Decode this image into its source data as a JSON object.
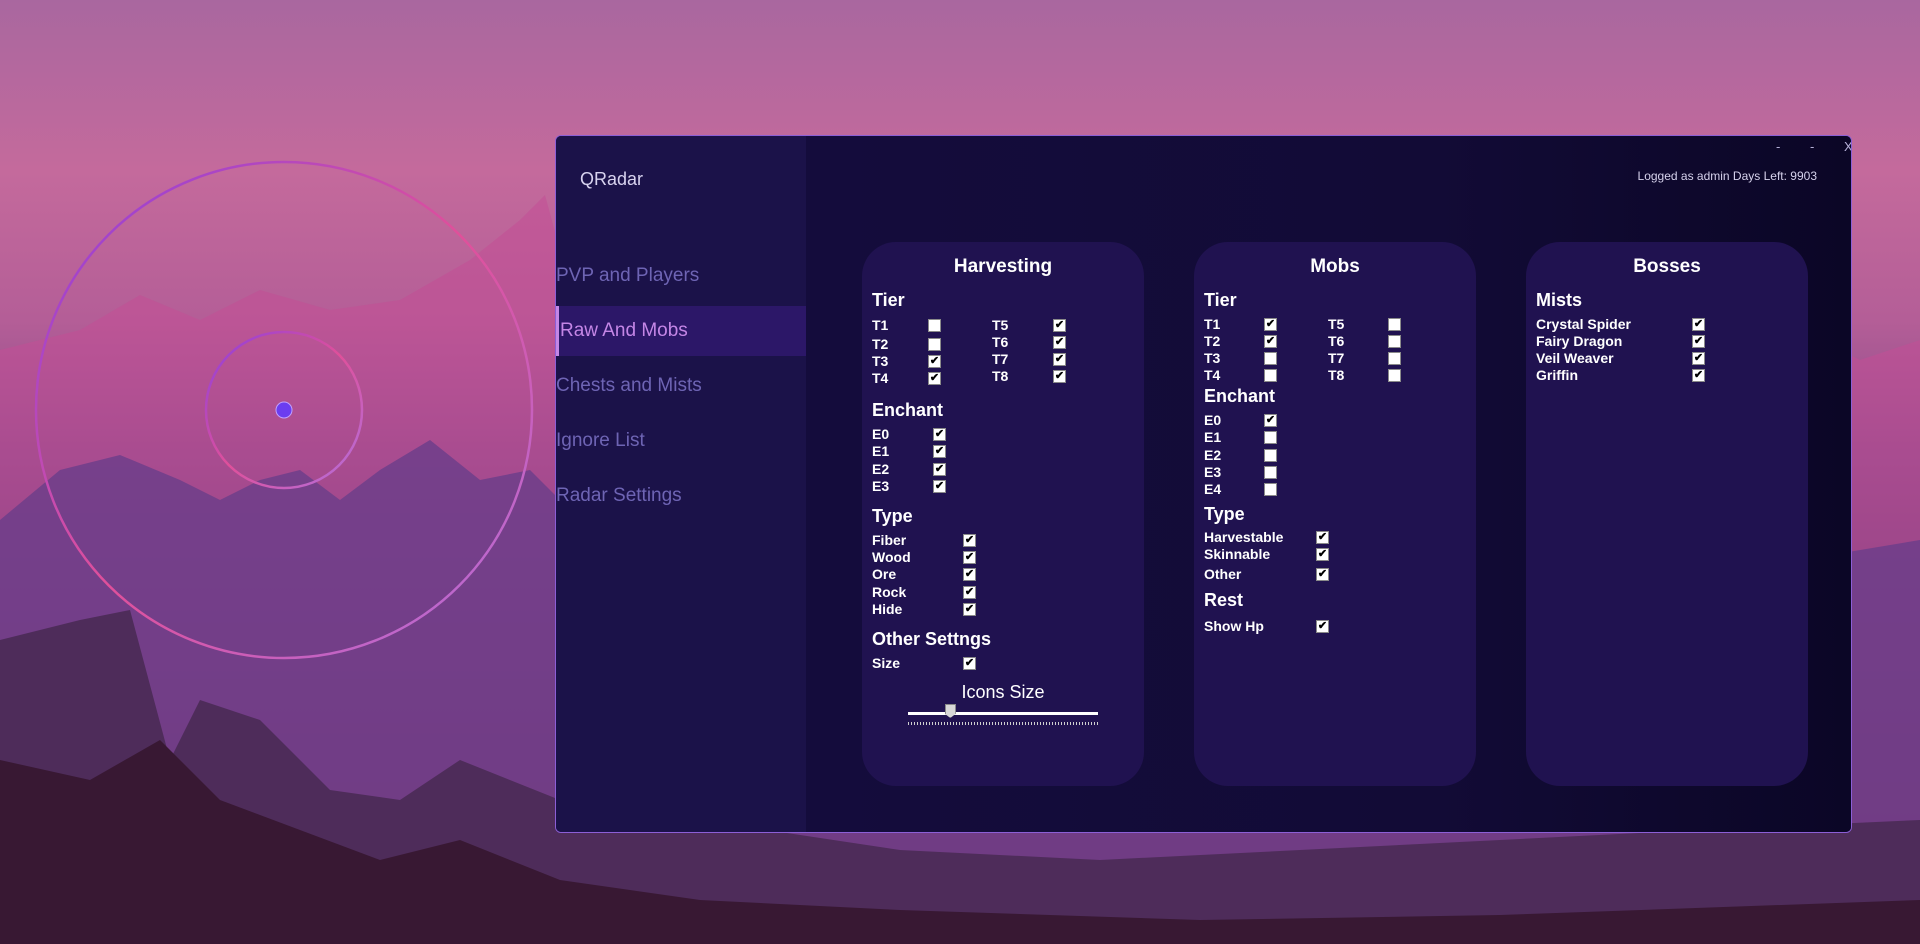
{
  "app": {
    "title": "QRadar"
  },
  "window_controls": {
    "minimize": "-",
    "maximize": "-",
    "close": "X"
  },
  "status": "Logged as admin Days Left: 9903",
  "nav": [
    {
      "label": "PVP and Players",
      "active": false
    },
    {
      "label": "Raw And Mobs",
      "active": true
    },
    {
      "label": "Chests and Mists",
      "active": false
    },
    {
      "label": "Ignore List",
      "active": false
    },
    {
      "label": "Radar Settings",
      "active": false
    }
  ],
  "harvesting": {
    "title": "Harvesting",
    "tier_title": "Tier",
    "tiers": [
      {
        "label": "T1",
        "checked": false
      },
      {
        "label": "T2",
        "checked": false
      },
      {
        "label": "T3",
        "checked": true
      },
      {
        "label": "T4",
        "checked": true
      },
      {
        "label": "T5",
        "checked": true
      },
      {
        "label": "T6",
        "checked": true
      },
      {
        "label": "T7",
        "checked": true
      },
      {
        "label": "T8",
        "checked": true
      }
    ],
    "enchant_title": "Enchant",
    "enchants": [
      {
        "label": "E0",
        "checked": true
      },
      {
        "label": "E1",
        "checked": true
      },
      {
        "label": "E2",
        "checked": true
      },
      {
        "label": "E3",
        "checked": true
      }
    ],
    "type_title": "Type",
    "types": [
      {
        "label": "Fiber",
        "checked": true
      },
      {
        "label": "Wood",
        "checked": true
      },
      {
        "label": "Ore",
        "checked": true
      },
      {
        "label": "Rock",
        "checked": true
      },
      {
        "label": "Hide",
        "checked": true
      }
    ],
    "other_title": "Other Settngs",
    "size": {
      "label": "Size",
      "checked": true
    },
    "icons_size_label": "Icons Size",
    "icons_size_value": 0.22
  },
  "mobs": {
    "title": "Mobs",
    "tier_title": "Tier",
    "tiers": [
      {
        "label": "T1",
        "checked": true
      },
      {
        "label": "T2",
        "checked": true
      },
      {
        "label": "T3",
        "checked": false
      },
      {
        "label": "T4",
        "checked": false
      },
      {
        "label": "T5",
        "checked": false
      },
      {
        "label": "T6",
        "checked": false
      },
      {
        "label": "T7",
        "checked": false
      },
      {
        "label": "T8",
        "checked": false
      }
    ],
    "enchant_title": "Enchant",
    "enchants": [
      {
        "label": "E0",
        "checked": true
      },
      {
        "label": "E1",
        "checked": false
      },
      {
        "label": "E2",
        "checked": false
      },
      {
        "label": "E3",
        "checked": false
      },
      {
        "label": "E4",
        "checked": false
      }
    ],
    "type_title": "Type",
    "types": [
      {
        "label": "Harvestable",
        "checked": true
      },
      {
        "label": "Skinnable",
        "checked": true
      },
      {
        "label": "Other",
        "checked": true
      }
    ],
    "rest_title": "Rest",
    "show_hp": {
      "label": "Show Hp",
      "checked": true
    }
  },
  "bosses": {
    "title": "Bosses",
    "mists_title": "Mists",
    "items": [
      {
        "label": "Crystal Spider",
        "checked": true
      },
      {
        "label": "Fairy Dragon",
        "checked": true
      },
      {
        "label": "Veil Weaver",
        "checked": true
      },
      {
        "label": "Griffin",
        "checked": true
      }
    ]
  },
  "colors": {
    "accent": "#c486e6",
    "window_bg": "#0f0a30",
    "panel_bg": "#201250",
    "sidebar_bg": "#1b1249"
  }
}
